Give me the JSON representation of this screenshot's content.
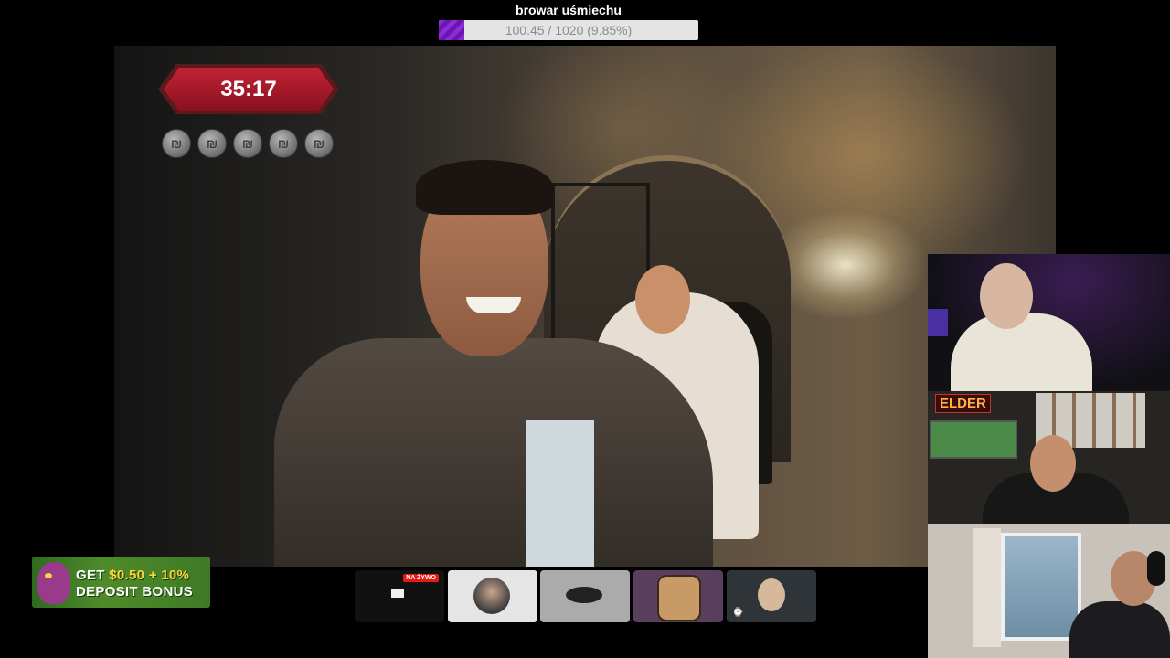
{
  "goal": {
    "title": "browar uśmiechu",
    "progress_text": "100.45 / 1020 (9.85%)",
    "current": 100.45,
    "target": 1020,
    "percent": 9.85,
    "fill_color": "#8f2bd6"
  },
  "overlay": {
    "timer": "35:17",
    "coin_glyph": "₪",
    "coin_count": 5
  },
  "cams": {
    "cam2_label": "ELDER"
  },
  "ad": {
    "line1_prefix": "GET ",
    "line1_accent": "$0.50 + 10%",
    "line2": "DEPOSIT BONUS"
  },
  "thumbnails": {
    "live_badge": "NA ŻYWO",
    "t5_icon": "⌚"
  },
  "colors": {
    "live_red": "#e91916",
    "timer_red": "#c12334",
    "ad_green": "#4f8b2a"
  }
}
